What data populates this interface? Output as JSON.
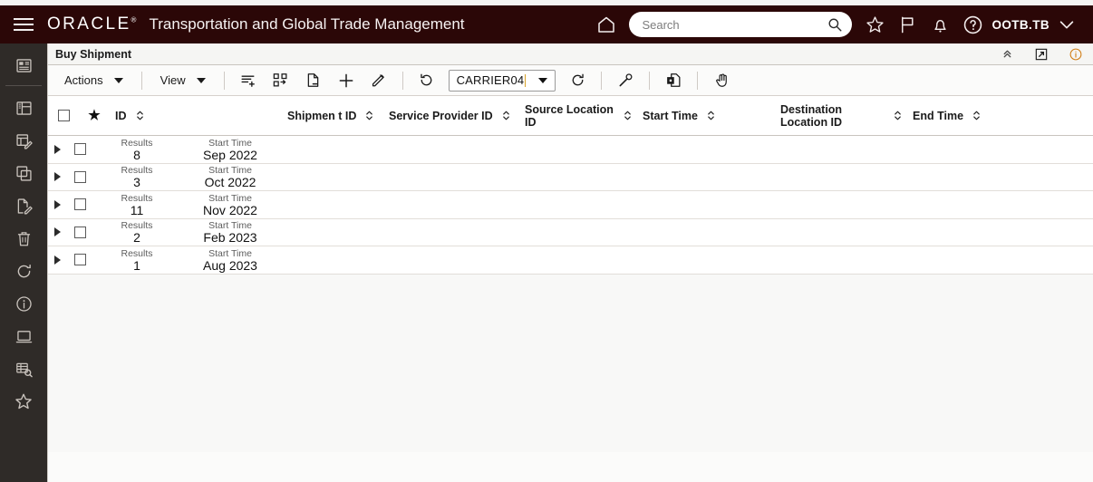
{
  "header": {
    "menu_icon": "hamburger-icon",
    "brand": "ORACLE",
    "brand_mark": "®",
    "app_title": "Transportation and Global Trade Management",
    "home_icon": "home-icon",
    "search_placeholder": "Search",
    "search_value": "",
    "search_icon": "search-icon",
    "favorites_icon": "star-icon",
    "flag_icon": "flag-icon",
    "notifications_icon": "bell-icon",
    "help_icon": "help-circle-icon",
    "user_name": "OOTB.TB",
    "user_caret_icon": "chevron-down-icon"
  },
  "sidebar": {
    "items": [
      {
        "name": "sidebar-item-report",
        "icon": "report-grid-icon"
      },
      {
        "name": "sidebar-item-layout",
        "icon": "layout-panels-icon"
      },
      {
        "name": "sidebar-item-edit-table",
        "icon": "table-edit-icon"
      },
      {
        "name": "sidebar-item-copy",
        "icon": "copy-icon"
      },
      {
        "name": "sidebar-item-edit-document",
        "icon": "document-edit-icon"
      },
      {
        "name": "sidebar-item-delete",
        "icon": "trash-icon"
      },
      {
        "name": "sidebar-item-refresh",
        "icon": "refresh-icon"
      },
      {
        "name": "sidebar-item-info",
        "icon": "info-circle-icon"
      },
      {
        "name": "sidebar-item-screen",
        "icon": "monitor-icon"
      },
      {
        "name": "sidebar-item-search-table",
        "icon": "table-search-icon"
      },
      {
        "name": "sidebar-item-favorite",
        "icon": "star-outline-icon"
      }
    ]
  },
  "tabbar": {
    "tab_label": "Buy Shipment",
    "collapse_icon": "chevron-up-double-icon",
    "popout_icon": "open-in-new-icon",
    "info_icon": "info-circle-icon"
  },
  "toolbar": {
    "actions_label": "Actions",
    "view_label": "View",
    "icons": [
      {
        "name": "add-to-list-button",
        "icon": "list-add-icon"
      },
      {
        "name": "workflow-button",
        "icon": "workflow-icon"
      },
      {
        "name": "remove-document-button",
        "icon": "document-minus-icon"
      },
      {
        "name": "add-button",
        "icon": "plus-icon"
      },
      {
        "name": "edit-button",
        "icon": "pencil-icon"
      },
      {
        "name": "refresh-button",
        "icon": "refresh-icon"
      },
      {
        "name": "tools-button",
        "icon": "wrench-icon"
      },
      {
        "name": "export-document-button",
        "icon": "document-export-icon"
      },
      {
        "name": "pan-button",
        "icon": "hand-icon"
      }
    ],
    "carrier_value": "CARRIER04",
    "carrier_caret_icon": "caret-down-icon"
  },
  "table": {
    "select_all_checkbox_icon": "checkbox-icon",
    "star_column_icon": "star-filled-icon",
    "columns": [
      {
        "label": "ID",
        "sortable": true
      },
      {
        "label": "Shipmen t ID",
        "sortable": true
      },
      {
        "label": "Service Provider ID",
        "sortable": true
      },
      {
        "label": "Source Location ID",
        "sortable": true
      },
      {
        "label": "Start Time",
        "sortable": true
      },
      {
        "label": "Destination Location ID",
        "sortable": true
      },
      {
        "label": "End Time",
        "sortable": true
      }
    ],
    "group_label_results": "Results",
    "group_label_start_time": "Start Time",
    "rows": [
      {
        "results": "8",
        "start_time": "Sep 2022"
      },
      {
        "results": "3",
        "start_time": "Oct 2022"
      },
      {
        "results": "11",
        "start_time": "Nov 2022"
      },
      {
        "results": "2",
        "start_time": "Feb 2023"
      },
      {
        "results": "1",
        "start_time": "Aug 2023"
      }
    ]
  },
  "colors": {
    "header_bg": "#2b0707",
    "sidebar_bg": "#2f2b28",
    "content_bg": "#fbfbfa",
    "accent": "#d8a22a"
  }
}
